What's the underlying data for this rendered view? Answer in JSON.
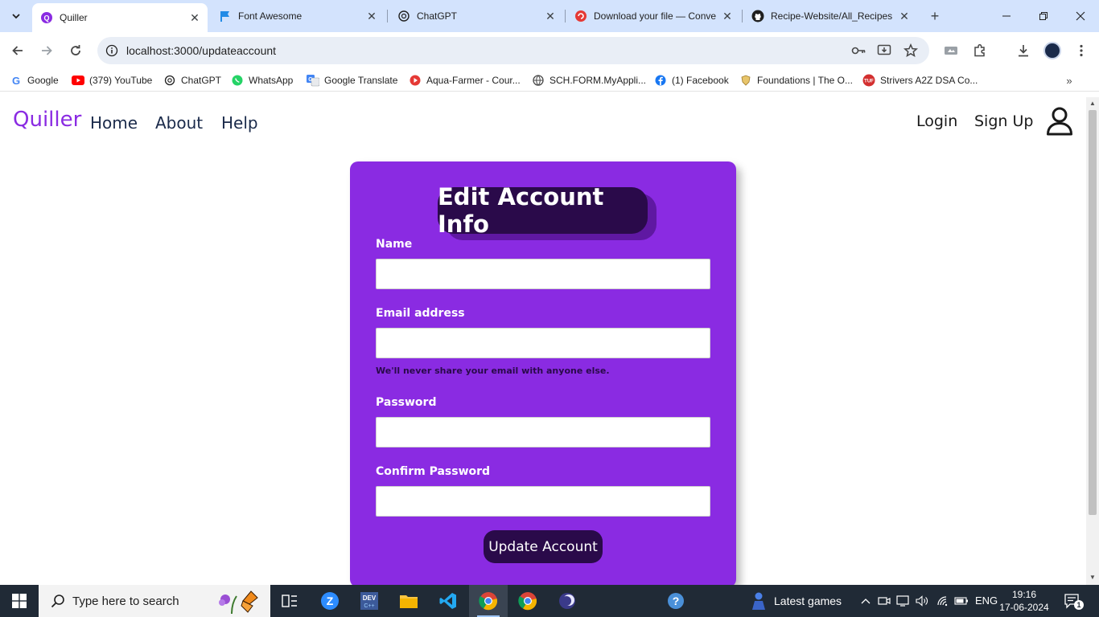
{
  "browser": {
    "tabs": [
      {
        "title": "Quiller",
        "icon": "quiller-icon",
        "active": true
      },
      {
        "title": "Font Awesome",
        "icon": "font-awesome-flag-icon",
        "active": false
      },
      {
        "title": "ChatGPT",
        "icon": "chatgpt-icon",
        "active": false
      },
      {
        "title": "Download your file — Conve",
        "icon": "convertio-icon",
        "active": false
      },
      {
        "title": "Recipe-Website/All_Recipes",
        "icon": "github-icon",
        "active": false
      }
    ],
    "url": "localhost:3000/updateaccount",
    "bookmarks": [
      {
        "label": "Google",
        "icon": "google-icon"
      },
      {
        "label": "(379) YouTube",
        "icon": "youtube-icon"
      },
      {
        "label": "ChatGPT",
        "icon": "chatgpt-icon"
      },
      {
        "label": "WhatsApp",
        "icon": "whatsapp-icon"
      },
      {
        "label": "Google Translate",
        "icon": "google-translate-icon"
      },
      {
        "label": "Aqua-Farmer - Cour...",
        "icon": "aqua-farmer-icon"
      },
      {
        "label": "SCH.FORM.MyAppli...",
        "icon": "globe-icon"
      },
      {
        "label": "(1) Facebook",
        "icon": "facebook-icon"
      },
      {
        "label": "Foundations | The O...",
        "icon": "odin-project-icon"
      },
      {
        "label": "Strivers A2Z DSA Co...",
        "icon": "tuf-icon"
      }
    ]
  },
  "site": {
    "brand": "Quiller",
    "nav": {
      "home": "Home",
      "about": "About",
      "help": "Help",
      "login": "Login",
      "signup": "Sign Up"
    },
    "colors": {
      "primary": "#8a2be2",
      "dark": "#2a0a4a"
    }
  },
  "form": {
    "title": "Edit Account Info",
    "name_label": "Name",
    "name_value": "",
    "email_label": "Email address",
    "email_value": "",
    "email_help": "We'll never share your email with anyone else.",
    "password_label": "Password",
    "password_value": "",
    "confirm_label": "Confirm Password",
    "confirm_value": "",
    "submit_label": "Update Account"
  },
  "taskbar": {
    "search_placeholder": "Type here to search",
    "news_label": "Latest games",
    "language": "ENG",
    "time": "19:16",
    "date": "17-06-2024",
    "notification_count": "1"
  }
}
